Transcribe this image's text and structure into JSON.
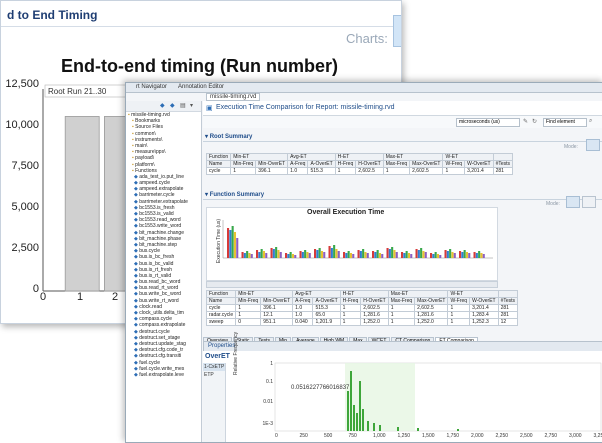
{
  "back_window": {
    "title": "d to End Timing",
    "charts_label": "Charts:",
    "chart_title": "End-to-end timing (Run number)",
    "legend_label": "Root Run 21..30",
    "y_ticks": [
      "12,500",
      "10,000",
      "7,500",
      "5,000",
      "2,500",
      "0"
    ],
    "x_ticks": [
      "0",
      "1",
      "2"
    ]
  },
  "chart_data": {
    "type": "bar",
    "title": "End-to-end timing (Run number)",
    "categories": [
      "1",
      "2"
    ],
    "values": [
      10800,
      10800
    ],
    "ylim": [
      0,
      12500
    ],
    "xlim": [
      0,
      2.5
    ],
    "series_name": "Root Run 21..30",
    "bar_color": "#d0d0d0"
  },
  "front_window": {
    "top_tabs": [
      "rt Navigator",
      "Annotation Editor",
      "missile-timing.rvd"
    ],
    "navigator_items": [
      "missile-timing.rvd",
      "Bookmarks",
      "Source Files",
      "common\\",
      "instruments\\",
      "main\\",
      "measure\\pps\\",
      "payload\\",
      "platform\\",
      "Functions",
      "ada_test_io.put_line",
      "ampeed.cycle",
      "ampeed.extrapolate",
      "barrimeter.cycle",
      "barrimeter.extrapolate",
      "bc1553.is_fresh",
      "bc1553.is_valid",
      "bc1553.read_word",
      "bc1553.write_word",
      "bit_machine.change",
      "bit_machine.phase",
      "bit_machine.step",
      "bus.cycle",
      "bus.is_bc_fresh",
      "bus.is_bc_valid",
      "bus.is_rt_fresh",
      "bus.is_rt_valid",
      "bus.read_bc_word",
      "bus.read_rt_word",
      "bus.write_bc_word",
      "bus.write_rt_word",
      "clock.read",
      "clock_utils.delta_tim",
      "compass.cycle",
      "compass.extrapolate",
      "destruct.cycle",
      "destruct.set_stage",
      "destruct.update_stag",
      "destruct.cfg.code_tr",
      "destruct.cfg.transiti",
      "fuel.cycle",
      "fuel.cycle.write_mes",
      "fuel.extrapolate.leve"
    ],
    "report_title": "Execution Time Comparison for Report: missile-timing.rvd",
    "units_select": "microseconds (us)",
    "find_select": "Find element",
    "root_summary_label": "Root Summary",
    "mode_label": "Mode:",
    "summary_groups": [
      "Function",
      "Min-ET",
      "Avg-ET",
      "H-ET",
      "Max-ET",
      "W-ET"
    ],
    "summary_headers": [
      "Name",
      "Min-Freq",
      "Min-OverET",
      "A-Freq",
      "A-OverET",
      "H-Freq",
      "H-OverET",
      "Max-Freq",
      "Max-OverET",
      "W-Freq",
      "W-OverET",
      "#Tests"
    ],
    "summary_rows": [
      [
        "cycle",
        "1",
        "396.1",
        "1.0",
        "515.3",
        "1",
        "2,602.5",
        "1",
        "2,602.5",
        "1",
        "3,201.4",
        "281"
      ]
    ],
    "function_summary_label": "Function Summary",
    "exec_chart_title": "Overall Execution Time",
    "exec_chart_ylabel": "Execution Time (us)",
    "func_headers": [
      "Name",
      "Min-Freq",
      "Min-OverET",
      "A-Freq",
      "A-OverET",
      "H-Freq",
      "H-OverET",
      "Max-Freq",
      "Max-OverET",
      "W-Freq",
      "W-OverET",
      "#Tests"
    ],
    "func_rows": [
      [
        "cycle",
        "1",
        "396.1",
        "1.0",
        "515.3",
        "1",
        "2,602.5",
        "1",
        "2,602.5",
        "1",
        "3,201.4",
        "281"
      ],
      [
        "radar.cycle",
        "1",
        "12.1",
        "1.0",
        "65.0",
        "1",
        "1,281.6",
        "1",
        "1,281.6",
        "1",
        "1,283.4",
        "281"
      ],
      [
        "sweep",
        "0",
        "951.1",
        "0.040",
        "1,201.9",
        "1",
        "1,252.0",
        "1",
        "1,252.0",
        "1",
        "1,252.3",
        "12"
      ]
    ],
    "bottom_tabs": [
      "Overview",
      "Static",
      "Tests",
      "Min",
      "Average",
      "High WM",
      "Max",
      "WCET",
      "CT Comparison",
      "ET Comparison"
    ],
    "properties_label": "Properties",
    "overet_label": "OverET",
    "side_items": [
      "1-CxETP",
      "ETP"
    ],
    "hist_y_label": "Relative Frequency",
    "hist_annotation": "0.0516227766016837",
    "hist_y_ticks": [
      "1",
      "0.1",
      "0.01",
      "1E-3"
    ],
    "hist_x_ticks": [
      "0",
      "250",
      "500",
      "750",
      "1,000",
      "1,250",
      "1,500",
      "1,750",
      "2,000",
      "2,250",
      "2,500",
      "2,750",
      "3,000",
      "3,250"
    ],
    "colors": {
      "accent": "#1f4d8a",
      "histogram": "#3ea63a",
      "chart_btn": "#d2e5f7"
    }
  }
}
